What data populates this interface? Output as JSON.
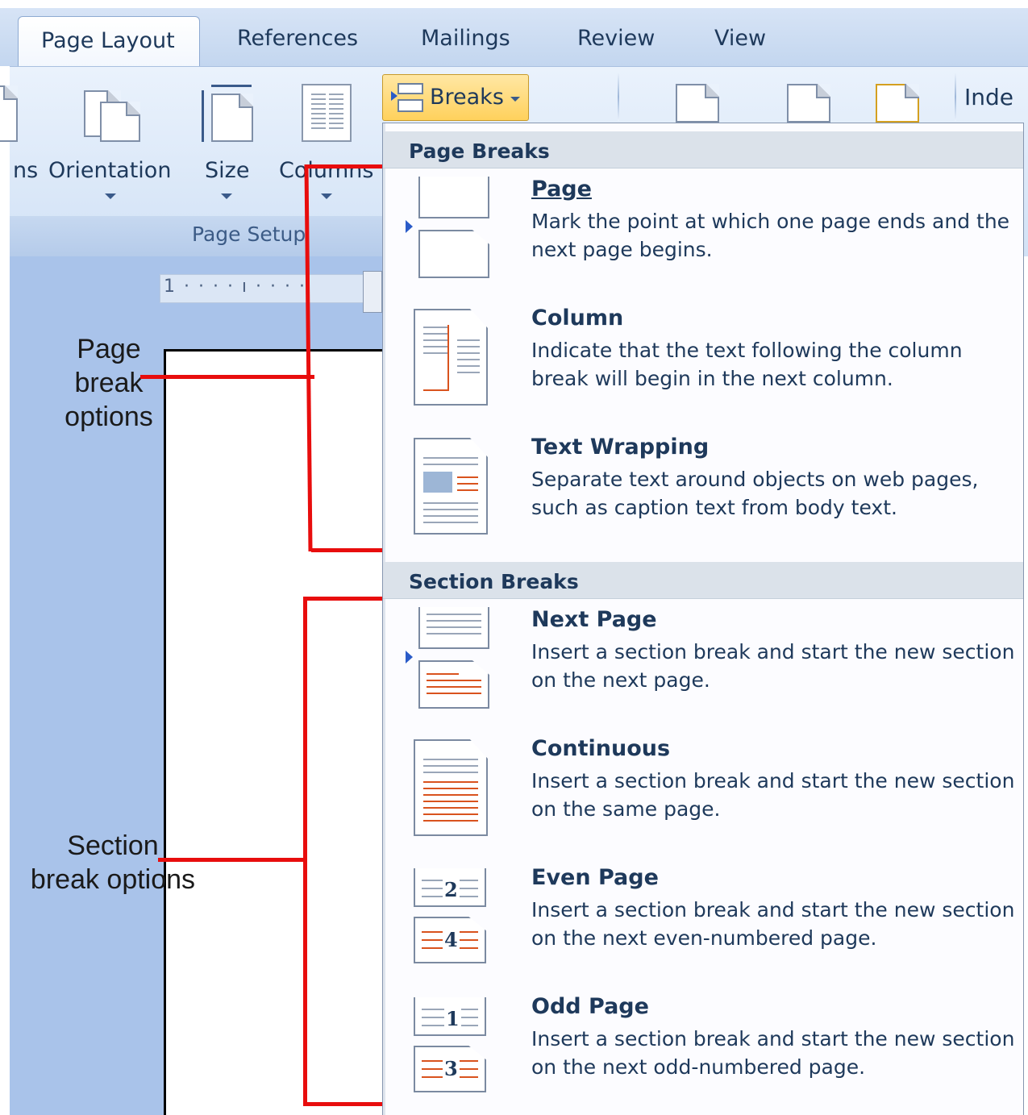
{
  "tabs": [
    {
      "label": "Page Layout",
      "active": true
    },
    {
      "label": "References"
    },
    {
      "label": "Mailings"
    },
    {
      "label": "Review"
    },
    {
      "label": "View"
    }
  ],
  "ribbon": {
    "margins_partial": "ns",
    "orientation": "Orientation",
    "size": "Size",
    "columns": "Columns",
    "breaks": "Breaks",
    "group_label": "Page Setup",
    "indent_partial": "Inde"
  },
  "ruler_text": "1 · · · · ı · · · ·",
  "annotations": {
    "page_break": "Page\nbreak\noptions",
    "section_break": "Section\nbreak options"
  },
  "menu": {
    "page_breaks_header": "Page Breaks",
    "section_breaks_header": "Section Breaks",
    "page_break_items": [
      {
        "title": "Page",
        "desc": "Mark the point at which one page ends and the next page begins."
      },
      {
        "title": "Column",
        "desc": "Indicate that the text following the column break will begin in the next column."
      },
      {
        "title": "Text Wrapping",
        "desc": "Separate text around objects on web pages, such as caption text from body text."
      }
    ],
    "section_break_items": [
      {
        "title": "Next Page",
        "desc": "Insert a section break and start the new section on the next page."
      },
      {
        "title": "Continuous",
        "desc": "Insert a section break and start the new section on the same page."
      },
      {
        "title": "Even Page",
        "desc": "Insert a section break and start the new section on the next even-numbered page.",
        "icon_numbers": [
          "2",
          "4"
        ]
      },
      {
        "title": "Odd Page",
        "desc": "Insert a section break and start the new section on the next odd-numbered page.",
        "icon_numbers": [
          "1",
          "3"
        ]
      }
    ]
  },
  "colors": {
    "annotation_line": "#e80d0d",
    "menu_text": "#1e395b",
    "breaks_highlight": "#ffd15c",
    "workspace": "#a9c3ea"
  }
}
